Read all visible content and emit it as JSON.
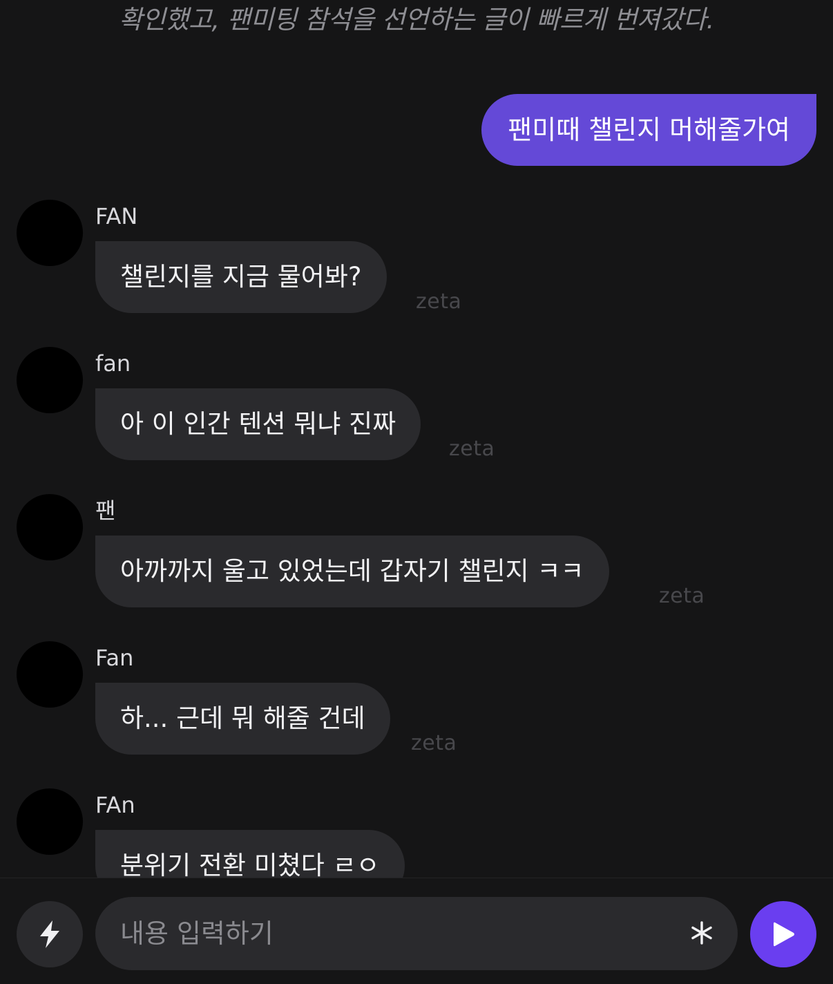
{
  "narration": {
    "text": "확인했고, 팬미팅 참석을 선언하는 글이 빠르게 번져갔다."
  },
  "user_message": {
    "text": "팬미때 챌린지 머해줄가여"
  },
  "messages": [
    {
      "sender": "FAN",
      "text": "챌린지를 지금 물어봐?",
      "tag": "zeta"
    },
    {
      "sender": "fan",
      "text": "아 이 인간 텐션 뭐냐 진짜",
      "tag": "zeta"
    },
    {
      "sender": "팬",
      "text": "아까까지 울고 있었는데 갑자기 챌린지 ㅋㅋ",
      "tag": "zeta"
    },
    {
      "sender": "Fan",
      "text": "하... 근데 뭐 해줄 건데",
      "tag": "zeta"
    },
    {
      "sender": "FAn",
      "text": "분위기 전환 미쳤다 ㄹㅇ",
      "tag": ""
    }
  ],
  "input": {
    "placeholder": "내용 입력하기",
    "value": ""
  },
  "icons": {
    "boost": "lightning-icon",
    "asterisk": "asterisk-icon",
    "send": "play-send-icon"
  },
  "colors": {
    "background": "#151516",
    "bubble": "#2a2a2d",
    "user_bubble": "#6449d7",
    "send_button": "#6a3ef0"
  }
}
